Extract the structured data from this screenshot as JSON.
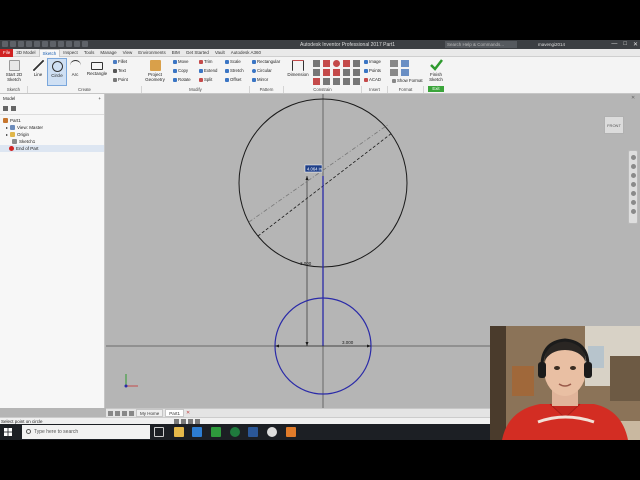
{
  "window": {
    "title": "Autodesk Inventor Professional 2017    Part1",
    "search_placeholder": "Search Help & Commands...",
    "user": "mavengi2014",
    "controls": [
      "—",
      "□",
      "✕"
    ]
  },
  "ribbon_tabs": [
    "File",
    "3D Model",
    "Sketch",
    "Inspect",
    "Tools",
    "Manage",
    "View",
    "Environments",
    "BIM",
    "Get Started",
    "Vault",
    "Autodesk A360"
  ],
  "ribbon": {
    "start_sketch": "Start 2D Sketch",
    "line": "Line",
    "circle": "Circle",
    "arc": "Arc",
    "rectangle": "Rectangle",
    "fillet": "Fillet",
    "text": "Text",
    "point": "Point",
    "project_geometry": "Project Geometry",
    "move": "Move",
    "copy": "Copy",
    "rotate": "Rotate",
    "trim": "Trim",
    "extend": "Extend",
    "split": "Split",
    "scale": "Scale",
    "stretch": "Stretch",
    "offset": "Offset",
    "rectangular": "Rectangular",
    "circular": "Circular",
    "mirror": "Mirror",
    "dimension": "Dimension",
    "image": "Image",
    "points": "Points",
    "acad": "ACAD",
    "show_format": "Show Format",
    "finish_sketch": "Finish Sketch",
    "panels": {
      "sketch": "Sketch",
      "create": "Create",
      "modify": "Modify",
      "pattern": "Pattern",
      "constrain": "Constrain",
      "insert": "Insert",
      "format": "Format",
      "exit": "Exit"
    }
  },
  "browser": {
    "title": "Model",
    "items": [
      "Part1",
      "View: Master",
      "Origin",
      "Sketch1",
      "End of Part"
    ]
  },
  "canvas": {
    "viewcube_label": "FRONT",
    "dim_input_value": "4.064 in",
    "dim_vertical": "3.000",
    "dim_horizontal": "3.000"
  },
  "document_tabs": [
    "My Home",
    "Part1"
  ],
  "status": {
    "message": "Select point on circle"
  },
  "taskbar": {
    "search_placeholder": "Type here to search"
  },
  "colors": {
    "accent": "#1c5fb0",
    "file_tab": "#d02222",
    "sketch_line": "#1a1a1a",
    "selected_geometry": "#2a2aa8",
    "finish_green": "#3ba53b"
  }
}
